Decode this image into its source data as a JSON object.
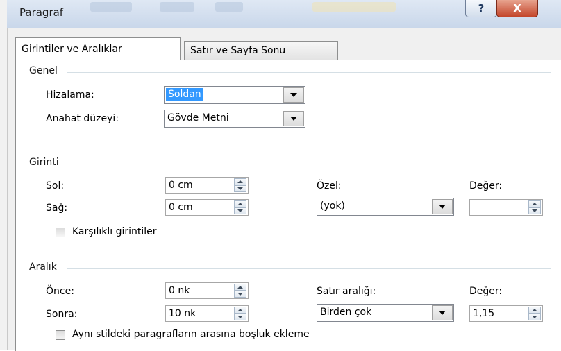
{
  "window": {
    "title": "Paragraf",
    "help_glyph": "?",
    "close_glyph": "X"
  },
  "tabs": [
    {
      "label": "Girintiler ve Aralıklar",
      "active": true
    },
    {
      "label": "Satır ve Sayfa Sonu",
      "active": false
    }
  ],
  "general": {
    "heading": "Genel",
    "alignment_label": "Hizalama:",
    "alignment_value": "Soldan",
    "outline_label": "Anahat düzeyi:",
    "outline_value": "Gövde Metni"
  },
  "indent": {
    "heading": "Girinti",
    "left_label": "Sol:",
    "left_value": "0 cm",
    "right_label": "Sağ:",
    "right_value": "0 cm",
    "special_label": "Özel:",
    "special_value": "(yok)",
    "by_label": "Değer:",
    "by_value": "",
    "mirror_label": "Karşılıklı girintiler",
    "mirror_checked": false
  },
  "spacing": {
    "heading": "Aralık",
    "before_label": "Önce:",
    "before_value": "0 nk",
    "after_label": "Sonra:",
    "after_value": "10 nk",
    "line_label": "Satır aralığı:",
    "line_value": "Birden çok",
    "at_label": "Değer:",
    "at_value": "1,15",
    "no_space_label": "Aynı stildeki paragrafların arasına boşluk ekleme",
    "no_space_checked": false
  },
  "colors": {
    "selection": "#3399ff",
    "close_button": "#c3452a",
    "title_bar": "#dfe8f4"
  }
}
